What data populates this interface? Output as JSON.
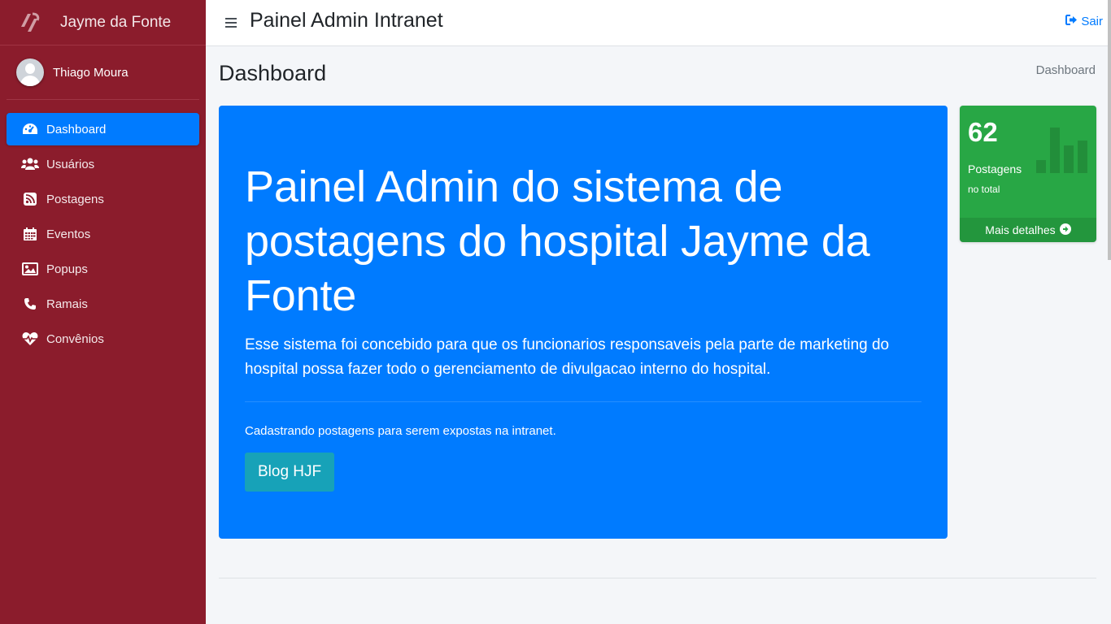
{
  "sidebar": {
    "brand": "Jayme da Fonte",
    "brand_icon": "hospital-logo-icon",
    "user_name": "Thiago Moura",
    "items": [
      {
        "label": "Dashboard",
        "icon": "tachometer-icon",
        "active": true
      },
      {
        "label": "Usuários",
        "icon": "users-icon"
      },
      {
        "label": "Postagens",
        "icon": "rss-icon"
      },
      {
        "label": "Eventos",
        "icon": "calendar-icon"
      },
      {
        "label": "Popups",
        "icon": "image-icon"
      },
      {
        "label": "Ramais",
        "icon": "phone-icon"
      },
      {
        "label": "Convênios",
        "icon": "heartbeat-icon"
      }
    ],
    "color": "#8b1c2c",
    "active_color": "#007bff"
  },
  "navbar": {
    "title": "Painel Admin Intranet",
    "logout_label": "Sair"
  },
  "content": {
    "page_title": "Dashboard",
    "breadcrumb": "Dashboard"
  },
  "jumbotron": {
    "title": "Painel Admin do sistema de postagens do hospital Jayme da Fonte",
    "lead": "Esse sistema foi concebido para que os funcionarios responsaveis pela parte de marketing do hospital possa fazer todo o gerenciamento de divulgacao interno do hospital.",
    "text": "Cadastrando postagens para serem expostas na intranet.",
    "button_label": "Blog HJF",
    "color": "#007bff",
    "button_color": "#17a2b8"
  },
  "stat_box": {
    "value": "62",
    "label": "Postagens",
    "sublabel": "no total",
    "footer_label": "Mais detalhes",
    "icon": "bar-chart-icon",
    "color": "#28a745"
  }
}
